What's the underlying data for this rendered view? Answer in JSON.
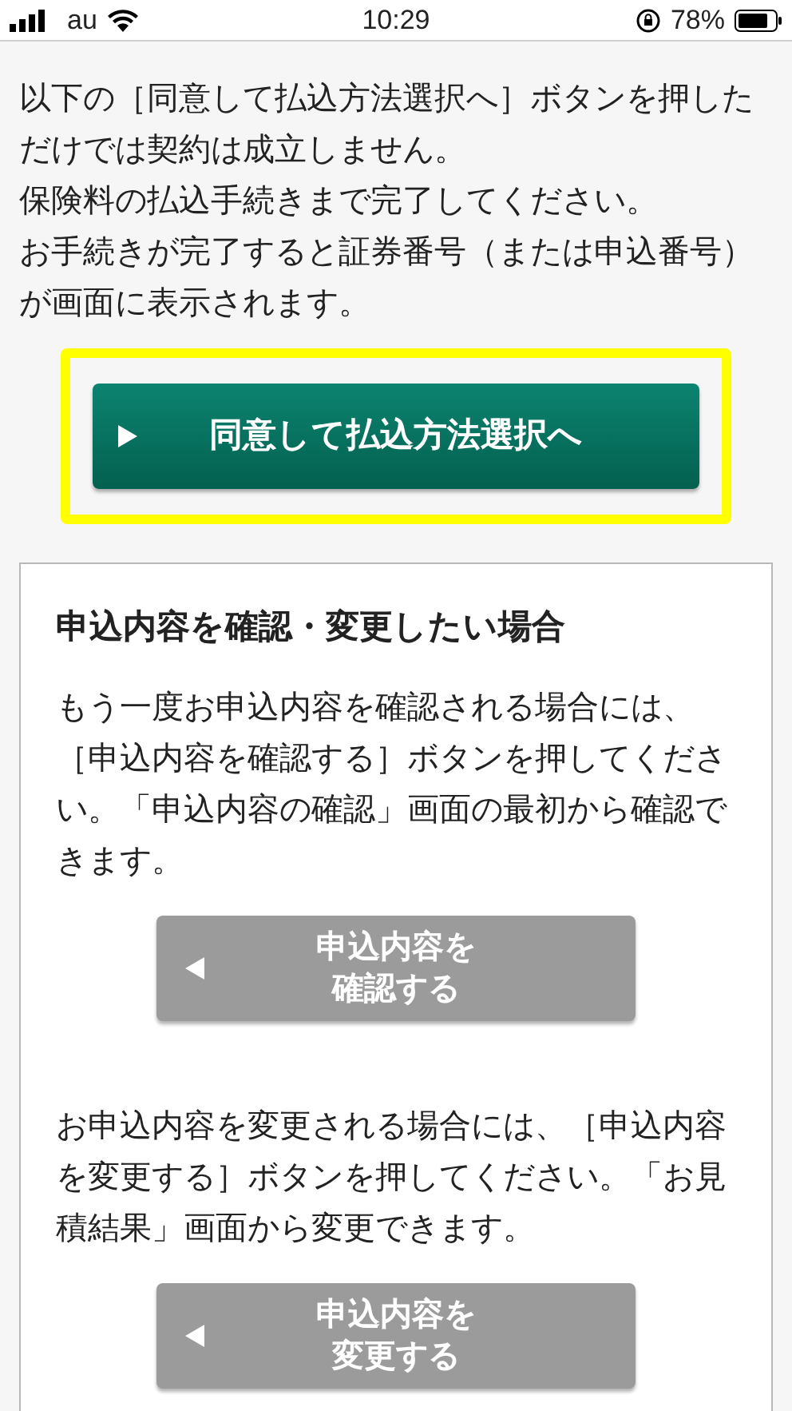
{
  "status_bar": {
    "carrier": "au",
    "time": "10:29",
    "battery": "78%"
  },
  "intro": [
    "以下の［同意して払込方法選択へ］ボタンを押しただけでは契約は成立しません。",
    "保険料の払込手続きまで完了してください。",
    "お手続きが完了すると証券番号（または申込番号）が画面に表示されます。"
  ],
  "primary_button": {
    "label": "同意して払込方法選択へ",
    "highlighted": true
  },
  "section": {
    "title": "申込内容を確認・変更したい場合",
    "blocks": [
      {
        "text": "もう一度お申込内容を確認される場合には、［申込内容を確認する］ボタンを押してください。「申込内容の確認」画面の最初から確認できます。",
        "button": "申込内容を確認する"
      },
      {
        "text": "お申込内容を変更される場合には、［申込内容を変更する］ボタンを押してください。「お見積結果」画面から変更できます。",
        "button": "申込内容を変更する"
      }
    ]
  }
}
